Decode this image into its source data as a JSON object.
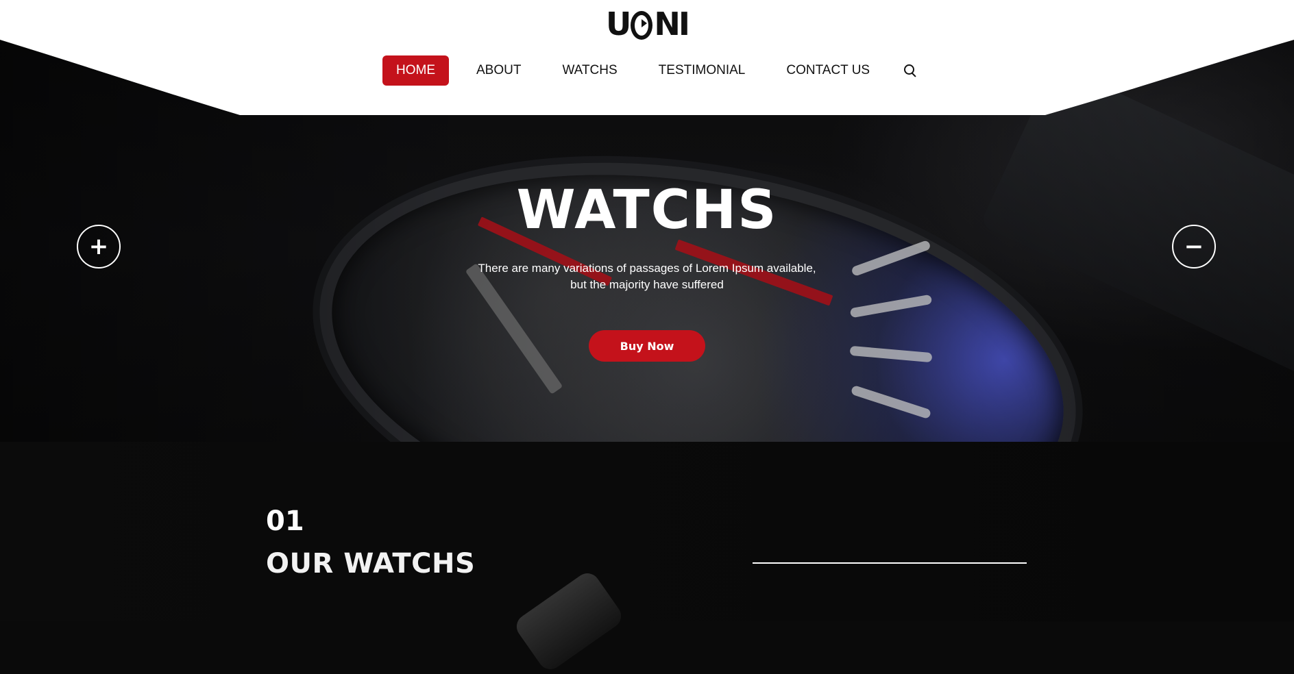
{
  "brand": {
    "logo_text": "UONI"
  },
  "nav": {
    "items": [
      {
        "label": "HOME",
        "active": true
      },
      {
        "label": "ABOUT",
        "active": false
      },
      {
        "label": "WATCHS",
        "active": false
      },
      {
        "label": "TESTIMONIAL",
        "active": false
      },
      {
        "label": "CONTACT US",
        "active": false
      }
    ],
    "search_icon": "search-icon"
  },
  "hero": {
    "title": "WATCHS",
    "subtitle": "There are many variations of passages of Lorem Ipsum available, but the majority have suffered",
    "cta_label": "Buy Now",
    "prev_icon": "+",
    "next_icon": "−"
  },
  "section": {
    "number": "01",
    "title": "OUR WATCHS"
  },
  "colors": {
    "accent": "#c4121b",
    "background": "#0a0a0a",
    "header_bg": "#ffffff"
  }
}
